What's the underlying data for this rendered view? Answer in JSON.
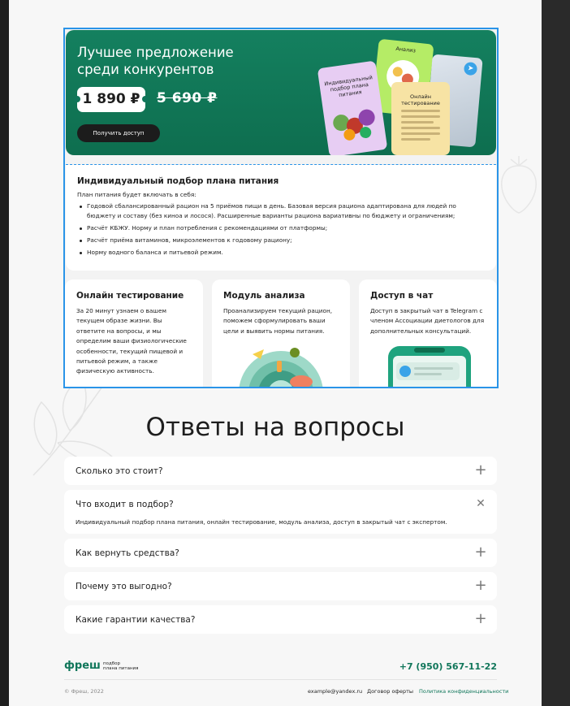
{
  "hero": {
    "title": "Лучшее предложение среди конкурентов",
    "price_new": "1 890 ₽",
    "price_old": "5 690 ₽",
    "button": "Получить доступ",
    "cards": {
      "analysis": "Анализ",
      "plan": "Индивидуальный подбор плана питания",
      "testing": "Онлайн тестирование"
    }
  },
  "plan": {
    "title": "Индивидуальный подбор плана питания",
    "subtitle": "План питания будет включать в себя:",
    "items": [
      "Годовой сбалансированный рацион на 5 приёмов пищи в день. Базовая версия рациона адаптирована для людей по бюджету и составу (без киноа и лосося). Расширенные варианты рациона вариативны по бюджету и ограничениям;",
      "Расчёт КБЖУ. Норму и план потребления с рекомендациями от платформы;",
      "Расчёт приёма витаминов, микроэлементов к годовому рациону;",
      "Норму водного баланса и питьевой режим."
    ]
  },
  "features": [
    {
      "title": "Онлайн тестирование",
      "text": "За 20 минут узнаем о вашем текущем образе жизни. Вы ответите на вопросы, и мы определим ваши физиологические особенности, текущий пищевой и питьевой режим, а также физическую активность."
    },
    {
      "title": "Модуль анализа",
      "text": "Проанализируем текущий рацион, поможем сформулировать ваши цели и выявить нормы питания."
    },
    {
      "title": "Доступ в чат",
      "text": "Доступ в закрытый чат в Telegram с членом Ассоциации диетологов для дополнительных консультаций."
    }
  ],
  "faq": {
    "heading": "Ответы на вопросы",
    "items": [
      {
        "q": "Сколько это стоит?",
        "a": "",
        "icon": "plus-icon"
      },
      {
        "q": "Что входит в подбор?",
        "a": "Индивидуальный подбор плана питания, онлайн тестирование, модуль анализа, доступ в закрытый чат с экспертом.",
        "icon": "close-icon"
      },
      {
        "q": "Как вернуть средства?",
        "a": "",
        "icon": "plus-icon"
      },
      {
        "q": "Почему это выгодно?",
        "a": "",
        "icon": "plus-icon"
      },
      {
        "q": "Какие гарантии качества?",
        "a": "",
        "icon": "plus-icon"
      }
    ]
  },
  "footer": {
    "logo": "фреш",
    "tagline_1": "подбор",
    "tagline_2": "плана питания",
    "phone": "+7 (950) 567-11-22",
    "copyright": "© Фреш, 2022",
    "email": "example@yandex.ru",
    "offer": "Договор оферты",
    "privacy": "Политика конфиденциальности"
  },
  "colors": {
    "brand": "#10765a",
    "selection": "#2a94e8",
    "page": "#f7f7f7"
  }
}
